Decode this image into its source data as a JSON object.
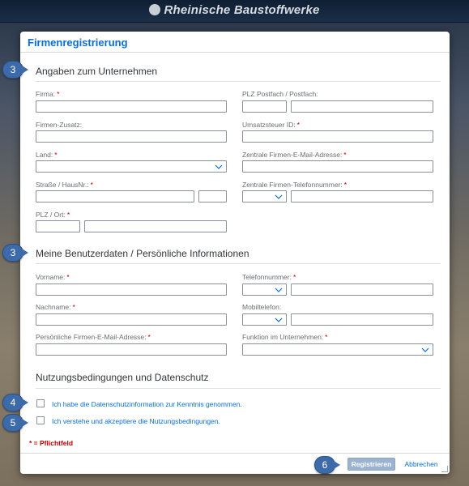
{
  "brand": {
    "name": "Rheinische Baustoffwerke"
  },
  "dialog": {
    "title": "Firmenregistrierung"
  },
  "sections": {
    "company": "Angaben zum Unternehmen",
    "personal": "Meine Benutzerdaten / Persönliche Informationen",
    "terms": "Nutzungsbedingungen und Datenschutz"
  },
  "labels": {
    "firma": "Firma:",
    "plz_postfach": "PLZ Postfach / Postfach:",
    "firmen_zusatz": "Firmen-Zusatz:",
    "ust_id": "Umsatzsteuer ID:",
    "land": "Land:",
    "zentrale_email": "Zentrale Firmen-E-Mail-Adresse:",
    "strasse": "Straße / HausNr.:",
    "zentrale_tel": "Zentrale Firmen-Telefonnummer:",
    "plz_ort": "PLZ / Ort:",
    "vorname": "Vorname:",
    "telefonnummer": "Telefonnummer:",
    "nachname": "Nachname:",
    "mobiltelefon": "Mobiltelefon:",
    "persoenliche_email": "Persönliche Firmen-E-Mail-Adresse:",
    "funktion": "Funktion im Unternehmen:"
  },
  "required_mark": "*",
  "checkboxes": {
    "datenschutz": "Ich habe die Datenschutzinformation zur Kenntnis genommen.",
    "nutzung": "Ich verstehe und akzeptiere die Nutzungsbedingungen."
  },
  "footnote": "* = Pflichtfeld",
  "buttons": {
    "register": "Registrieren",
    "cancel": "Abbrechen"
  },
  "markers": {
    "m1": "3",
    "m2": "3",
    "m3": "4",
    "m4": "5",
    "m5": "6"
  },
  "colors": {
    "accent": "#0a6ed1",
    "required": "#bb0000",
    "marker": "#3d6aa8"
  }
}
